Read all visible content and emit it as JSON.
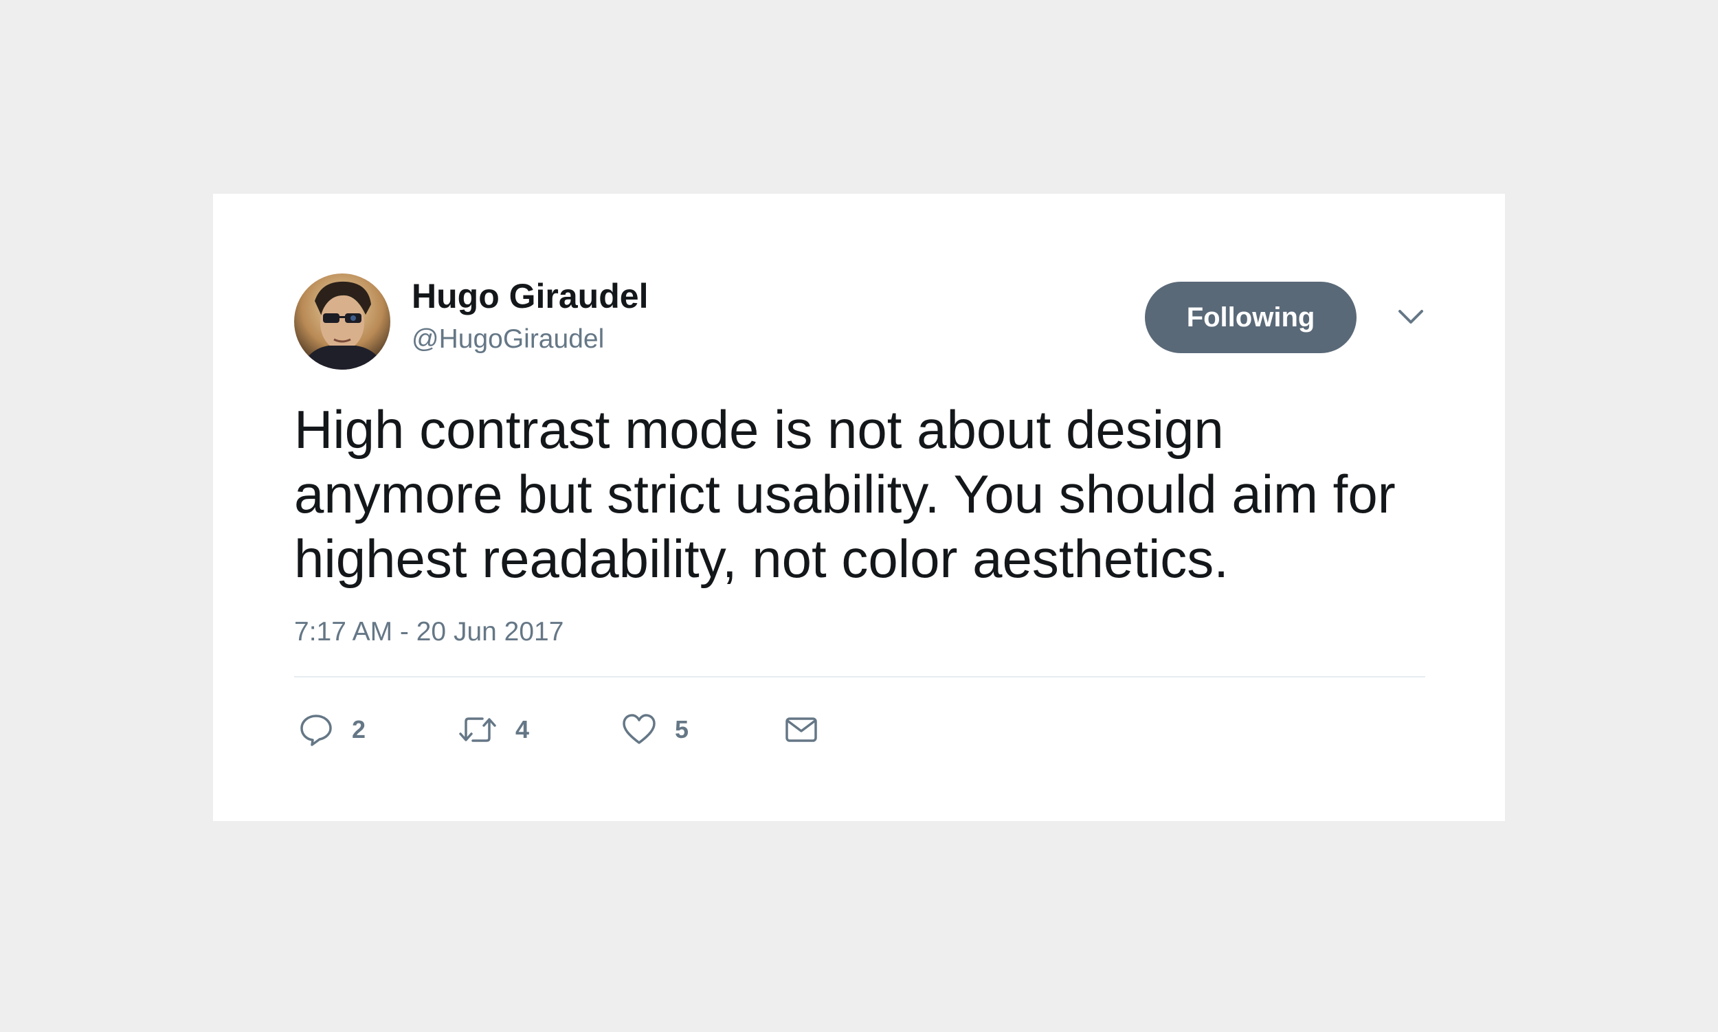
{
  "tweet": {
    "author": {
      "name": "Hugo Giraudel",
      "handle": "@HugoGiraudel",
      "avatar_icon": "user-avatar"
    },
    "follow_button_label": "Following",
    "menu_icon": "chevron-down-icon",
    "text": "High contrast mode is not about design anymore but strict usability. You should aim for highest readability, not color aesthetics.",
    "timestamp": "7:17 AM - 20 Jun 2017",
    "actions": {
      "reply_count": "2",
      "retweet_count": "4",
      "like_count": "5",
      "icons": [
        "reply-icon",
        "retweet-icon",
        "like-icon",
        "direct-message-icon"
      ]
    }
  },
  "colors": {
    "background": "#eeeeee",
    "card": "#ffffff",
    "primary_text": "#14171a",
    "secondary_text": "#657786",
    "button": "#5a6978",
    "divider": "#e6ecf0"
  }
}
